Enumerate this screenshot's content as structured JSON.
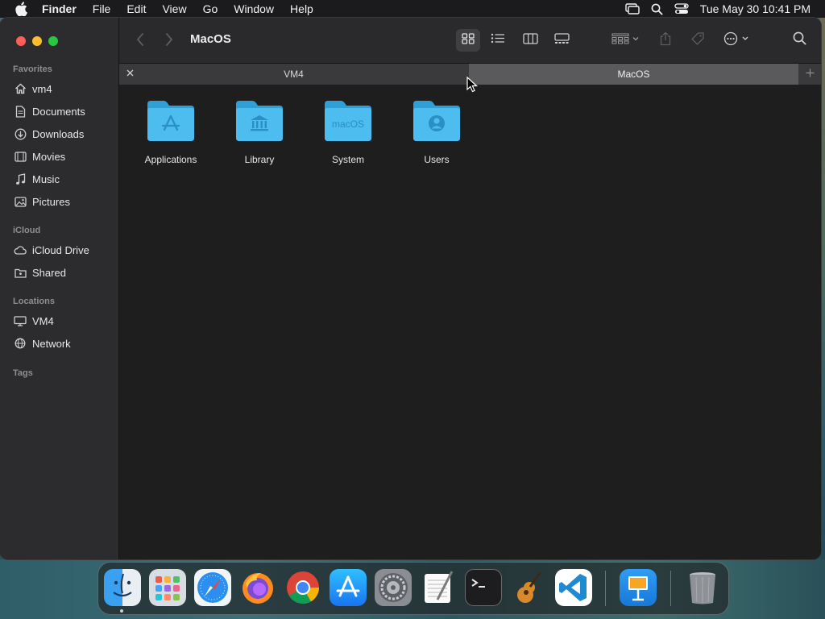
{
  "menubar": {
    "app_name": "Finder",
    "items": [
      "File",
      "Edit",
      "View",
      "Go",
      "Window",
      "Help"
    ],
    "clock": "Tue May 30  10:41 PM"
  },
  "window": {
    "title": "MacOS",
    "tabs": [
      {
        "label": "VM4",
        "active": false
      },
      {
        "label": "MacOS",
        "active": true
      }
    ]
  },
  "sidebar": {
    "favorites_label": "Favorites",
    "favorites": [
      {
        "label": "vm4",
        "icon": "house-icon"
      },
      {
        "label": "Documents",
        "icon": "document-icon"
      },
      {
        "label": "Downloads",
        "icon": "download-icon"
      },
      {
        "label": "Movies",
        "icon": "film-icon"
      },
      {
        "label": "Music",
        "icon": "music-note-icon"
      },
      {
        "label": "Pictures",
        "icon": "photo-icon"
      }
    ],
    "icloud_label": "iCloud",
    "icloud": [
      {
        "label": "iCloud Drive",
        "icon": "cloud-icon"
      },
      {
        "label": "Shared",
        "icon": "shared-folder-icon"
      }
    ],
    "locations_label": "Locations",
    "locations": [
      {
        "label": "VM4",
        "icon": "display-icon"
      },
      {
        "label": "Network",
        "icon": "globe-icon"
      }
    ],
    "tags_label": "Tags"
  },
  "files": [
    {
      "name": "Applications",
      "icon": "applications-folder-icon"
    },
    {
      "name": "Library",
      "icon": "library-folder-icon"
    },
    {
      "name": "System",
      "icon": "system-folder-icon",
      "badge": "macOS"
    },
    {
      "name": "Users",
      "icon": "users-folder-icon"
    }
  ],
  "colors": {
    "folder_blue": "#3fb4e8",
    "window_bg": "#1e1e1e",
    "sidebar_bg": "#2c2c2e"
  },
  "dock": {
    "apps": [
      "finder-icon",
      "launchpad-icon",
      "safari-icon",
      "firefox-icon",
      "chrome-icon",
      "app-store-icon",
      "system-settings-icon",
      "textedit-icon",
      "terminal-icon",
      "garageband-icon",
      "vscode-icon",
      "keynote-icon",
      "trash-icon"
    ]
  }
}
